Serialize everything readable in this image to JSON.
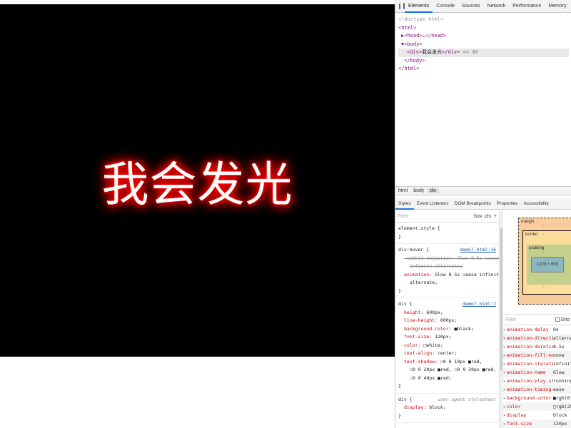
{
  "preview": {
    "glow_text": "我会发光"
  },
  "devtools": {
    "tabs": [
      "Elements",
      "Console",
      "Sources",
      "Network",
      "Performance",
      "Memory"
    ],
    "active_tab": "Elements",
    "more_tabs_glyph": "»",
    "dom_lines": [
      "<!doctype html>",
      "<html>",
      "▶<head>…</head>",
      "▼<body>",
      "<div>",
      "我会发光",
      "</div>",
      "== $0",
      "</body>",
      "</html>"
    ],
    "breadcrumbs": [
      "html",
      "body",
      "div"
    ],
    "side_tabs": [
      "Styles",
      "Event Listeners",
      "DOM Breakpoints",
      "Properties",
      "Accessibility"
    ],
    "styles": {
      "filter_placeholder": "Filter",
      "hov_cls": ":hov .cls",
      "add_glyph": "+",
      "rules": [
        {
          "selector": "element.style {",
          "source": "",
          "decls": [],
          "close": "}"
        },
        {
          "selector": "div:hover {",
          "source": "demo7.html:16",
          "decls": [
            {
              "name": "-webkit-animation:",
              "value": "Glow 0.5s ☑ease",
              "struck": true
            },
            {
              "name": "",
              "value": "infinite alternate;",
              "struck": true,
              "cont": true
            },
            {
              "name": "animation:",
              "value": "Glow 0.5s ☑ease infinite",
              "struck": false
            },
            {
              "name": "",
              "value": "alternate;",
              "struck": false,
              "cont": true
            }
          ],
          "close": "}"
        },
        {
          "selector": "div {",
          "source": "demo7.html:7",
          "decls": [
            {
              "name": "height:",
              "value": "600px;"
            },
            {
              "name": "line-height:",
              "value": "600px;"
            },
            {
              "name": "background-color:",
              "value": "■black;"
            },
            {
              "name": "font-size:",
              "value": "120px;"
            },
            {
              "name": "color:",
              "value": "□white;"
            },
            {
              "name": "text-align:",
              "value": "center;"
            },
            {
              "name": "text-shadow:",
              "value": "☐0 0 10px ■red,"
            },
            {
              "name": "",
              "value": "☐0 0 20px ■red, ☐0 0 30px ■red,",
              "cont": true
            },
            {
              "name": "",
              "value": "☐0 0 40px ■red;",
              "cont": true
            }
          ],
          "close": "}"
        },
        {
          "selector": "div {",
          "source": "user agent stylesheet",
          "ua": true,
          "decls": [
            {
              "name": "display:",
              "value": "block;"
            }
          ],
          "close": "}"
        }
      ]
    },
    "box_model": {
      "margin_label": "margin",
      "margin_value": "-",
      "border_label": "border",
      "border_value": "-",
      "padding_label": "padding",
      "padding_value": "-",
      "content_size": "1320 × 600",
      "bottom_dash": "-"
    },
    "computed": {
      "filter_placeholder": "Filter",
      "show_all_label": "Sho",
      "rows": [
        {
          "name": "animation-delay",
          "value": "0s"
        },
        {
          "name": "animation-directi…",
          "value": "alternate"
        },
        {
          "name": "animation-duratio…",
          "value": "0.5s"
        },
        {
          "name": "animation-fill-mo…",
          "value": "none"
        },
        {
          "name": "animation-iterati…",
          "value": "infinite"
        },
        {
          "name": "animation-name",
          "value": "Glow"
        },
        {
          "name": "animation-play-st…",
          "value": "running"
        },
        {
          "name": "animation-timing-…",
          "value": "ease"
        },
        {
          "name": "background-color",
          "value": "■rgb(0,"
        },
        {
          "name": "color",
          "value": "□rgb(25"
        },
        {
          "name": "display",
          "value": "block"
        },
        {
          "name": "font-size",
          "value": "120px"
        }
      ]
    }
  },
  "colors": {
    "glow": "#ff0000",
    "accent": "#1a73e8"
  }
}
